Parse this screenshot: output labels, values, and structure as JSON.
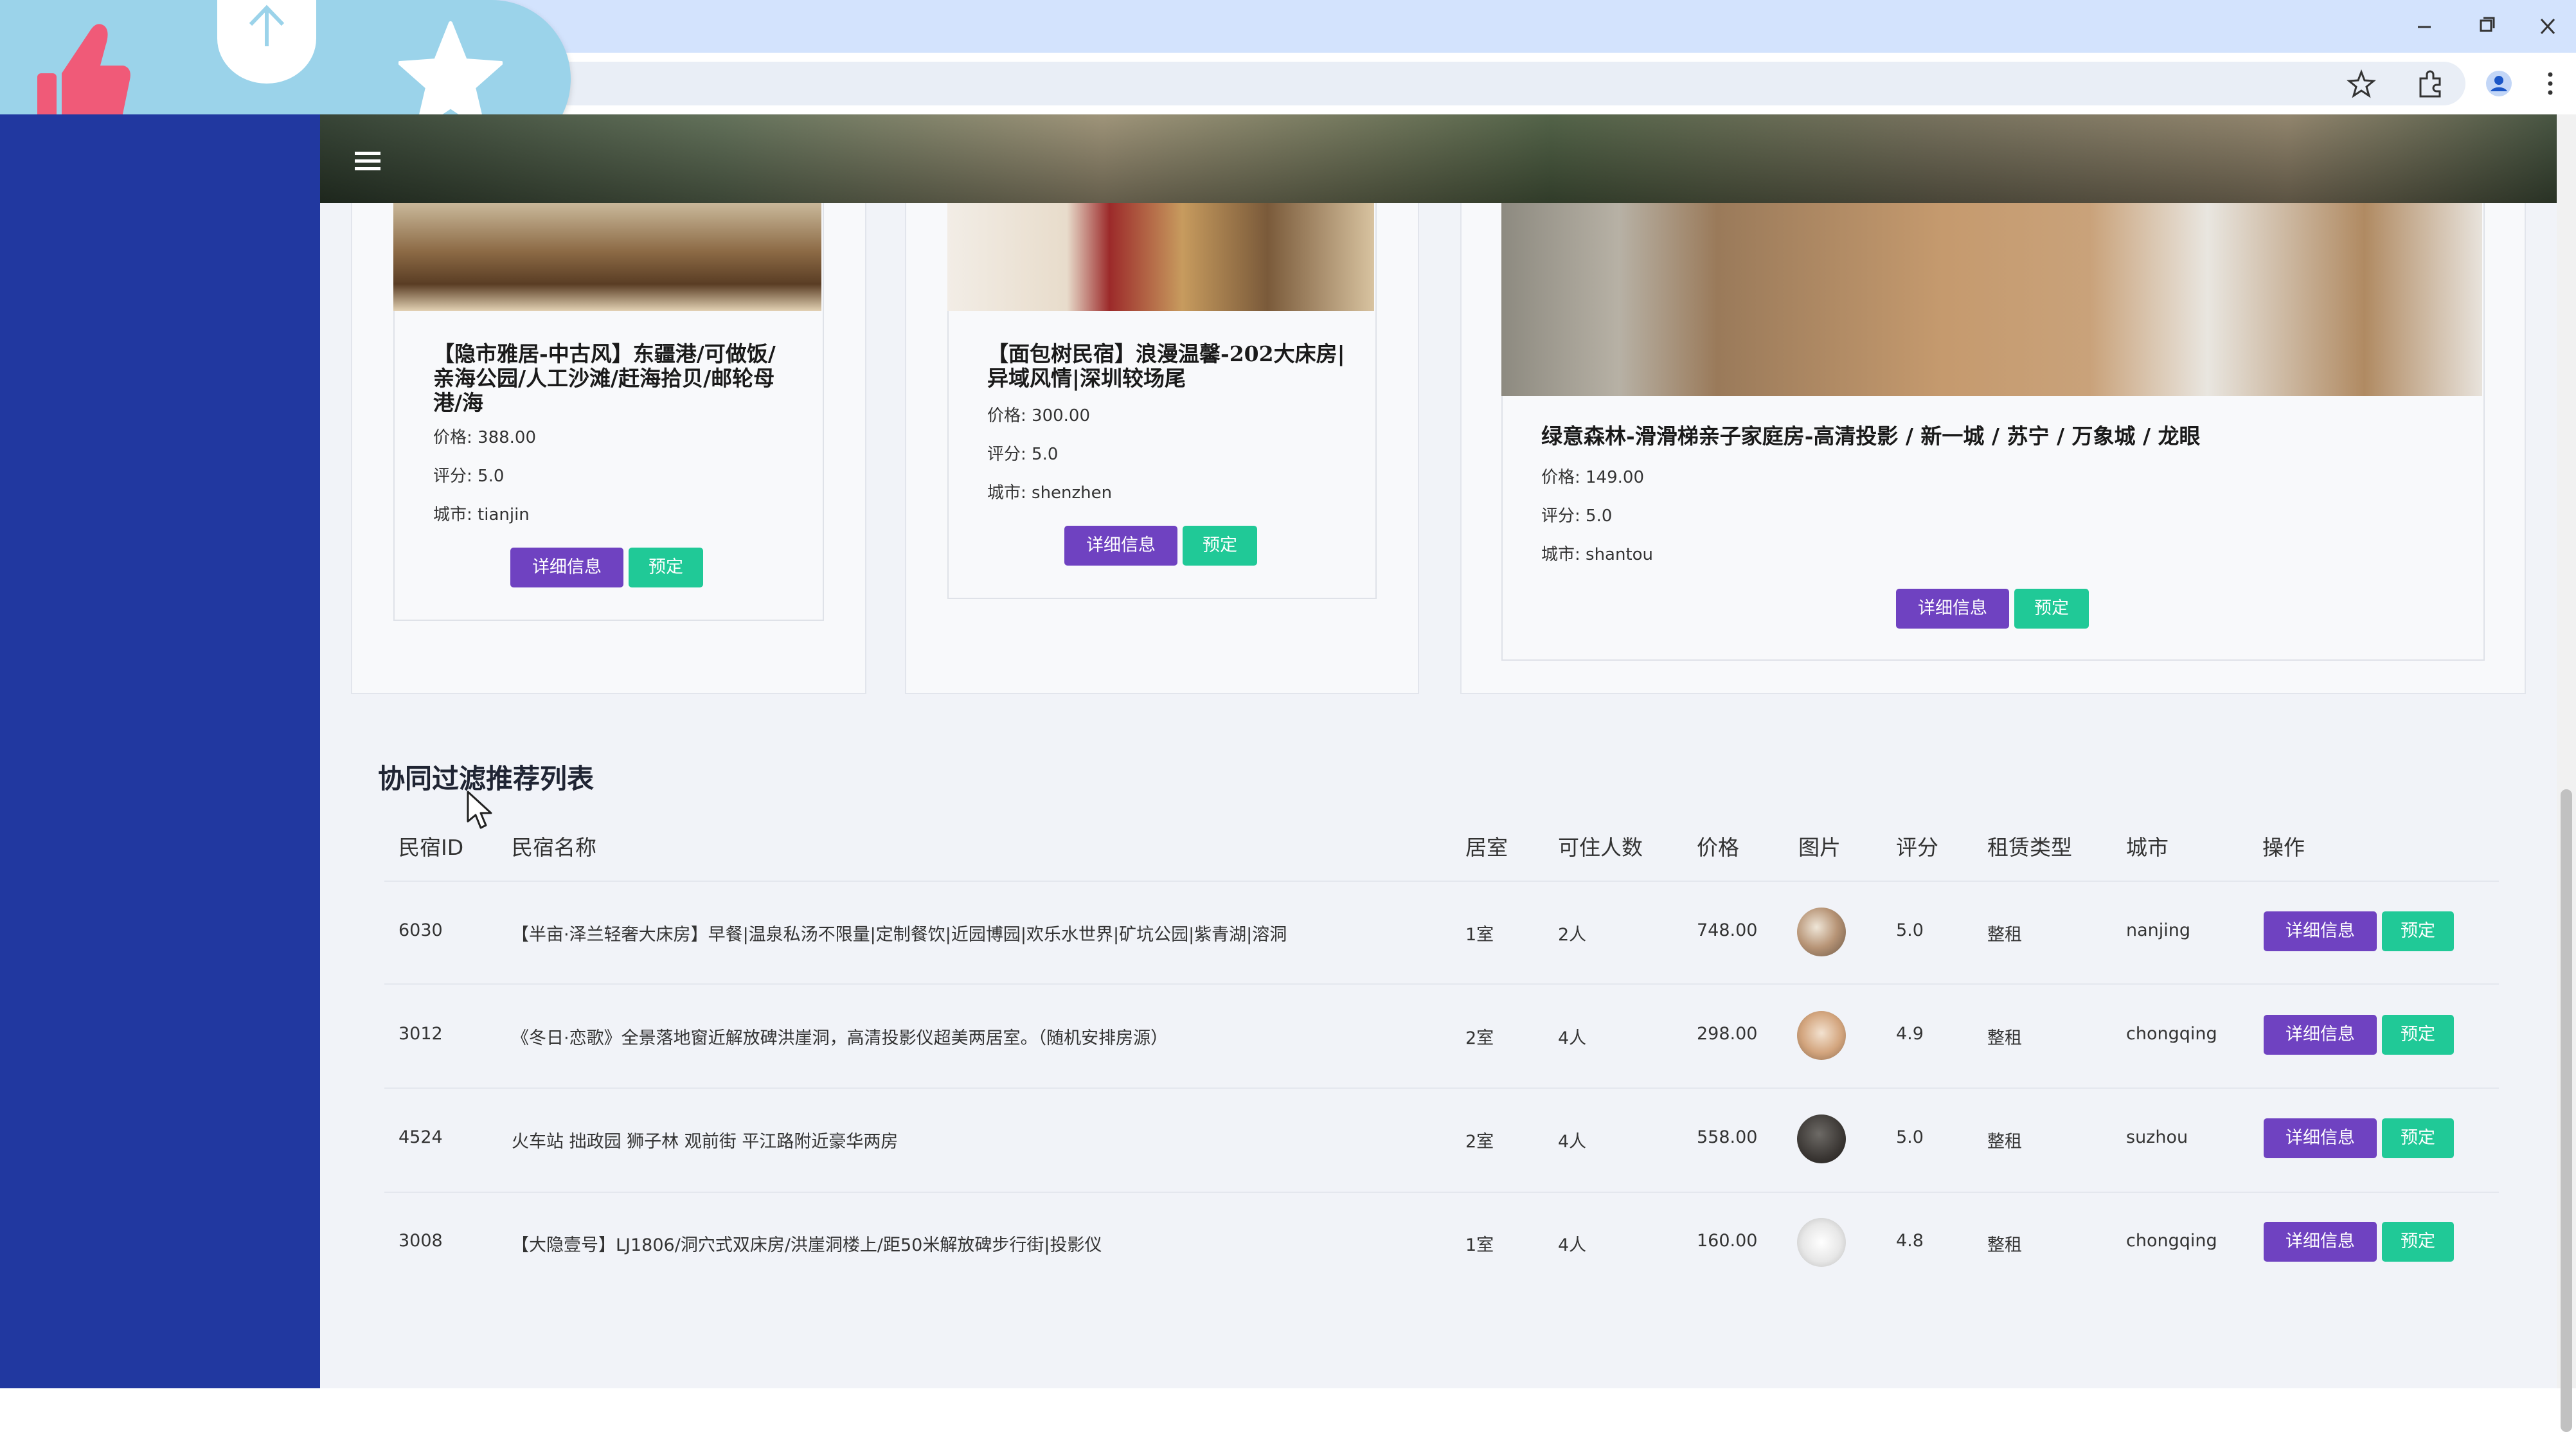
{
  "colors": {
    "sidebar": "#2138a0",
    "primary_button": "#6f42c1",
    "success_button": "#20c997",
    "widget": "#9bd3ea",
    "thumb": "#f05a78"
  },
  "icons": [
    "thumbs-up-icon",
    "upload-arrow-icon",
    "star-icon",
    "bookmark-star-icon",
    "extensions-icon",
    "profile-icon",
    "more-icon",
    "hamburger-menu-icon"
  ],
  "cards": [
    {
      "title": "【隐市雅居-中古风】东疆港/可做饭/亲海公园/人工沙滩/赶海拾贝/邮轮母港/海",
      "price_label": "价格: 388.00",
      "rating_label": "评分: 5.0",
      "city_label": "城市: tianjin",
      "detail_button": "详细信息",
      "book_button": "预定"
    },
    {
      "title": "【面包树民宿】浪漫温馨-202大床房|异域风情|深圳较场尾",
      "price_label": "价格: 300.00",
      "rating_label": "评分: 5.0",
      "city_label": "城市: shenzhen",
      "detail_button": "详细信息",
      "book_button": "预定"
    },
    {
      "title": "绿意森林-滑滑梯亲子家庭房-高清投影 / 新一城 / 苏宁 / 万象城 / 龙眼",
      "price_label": "价格: 149.00",
      "rating_label": "评分: 5.0",
      "city_label": "城市: shantou",
      "detail_button": "详细信息",
      "book_button": "预定"
    }
  ],
  "table": {
    "title": "协同过滤推荐列表",
    "headers": [
      "民宿ID",
      "民宿名称",
      "居室",
      "可住人数",
      "价格",
      "图片",
      "评分",
      "租赁类型",
      "城市",
      "操作"
    ],
    "rows": [
      {
        "id": "6030",
        "name": "【半亩·泽兰轻奢大床房】早餐|温泉私汤不限量|定制餐饮|近园博园|欢乐水世界|矿坑公园|紫青湖|溶洞",
        "rooms": "1室",
        "guests": "2人",
        "price": "748.00",
        "rating": "5.0",
        "rent_type": "整租",
        "city": "nanjing",
        "detail": "详细信息",
        "book": "预定"
      },
      {
        "id": "3012",
        "name": "《冬日·恋歌》全景落地窗近解放碑洪崖洞，高清投影仪超美两居室。（随机安排房源）",
        "rooms": "2室",
        "guests": "4人",
        "price": "298.00",
        "rating": "4.9",
        "rent_type": "整租",
        "city": "chongqing",
        "detail": "详细信息",
        "book": "预定"
      },
      {
        "id": "4524",
        "name": "火车站 拙政园 狮子林 观前街 平江路附近豪华两房",
        "rooms": "2室",
        "guests": "4人",
        "price": "558.00",
        "rating": "5.0",
        "rent_type": "整租",
        "city": "suzhou",
        "detail": "详细信息",
        "book": "预定"
      },
      {
        "id": "3008",
        "name": "【大隐壹号】LJ1806/洞穴式双床房/洪崖洞楼上/距50米解放碑步行街|投影仪",
        "rooms": "1室",
        "guests": "4人",
        "price": "160.00",
        "rating": "4.8",
        "rent_type": "整租",
        "city": "chongqing",
        "detail": "详细信息",
        "book": "预定"
      }
    ]
  }
}
